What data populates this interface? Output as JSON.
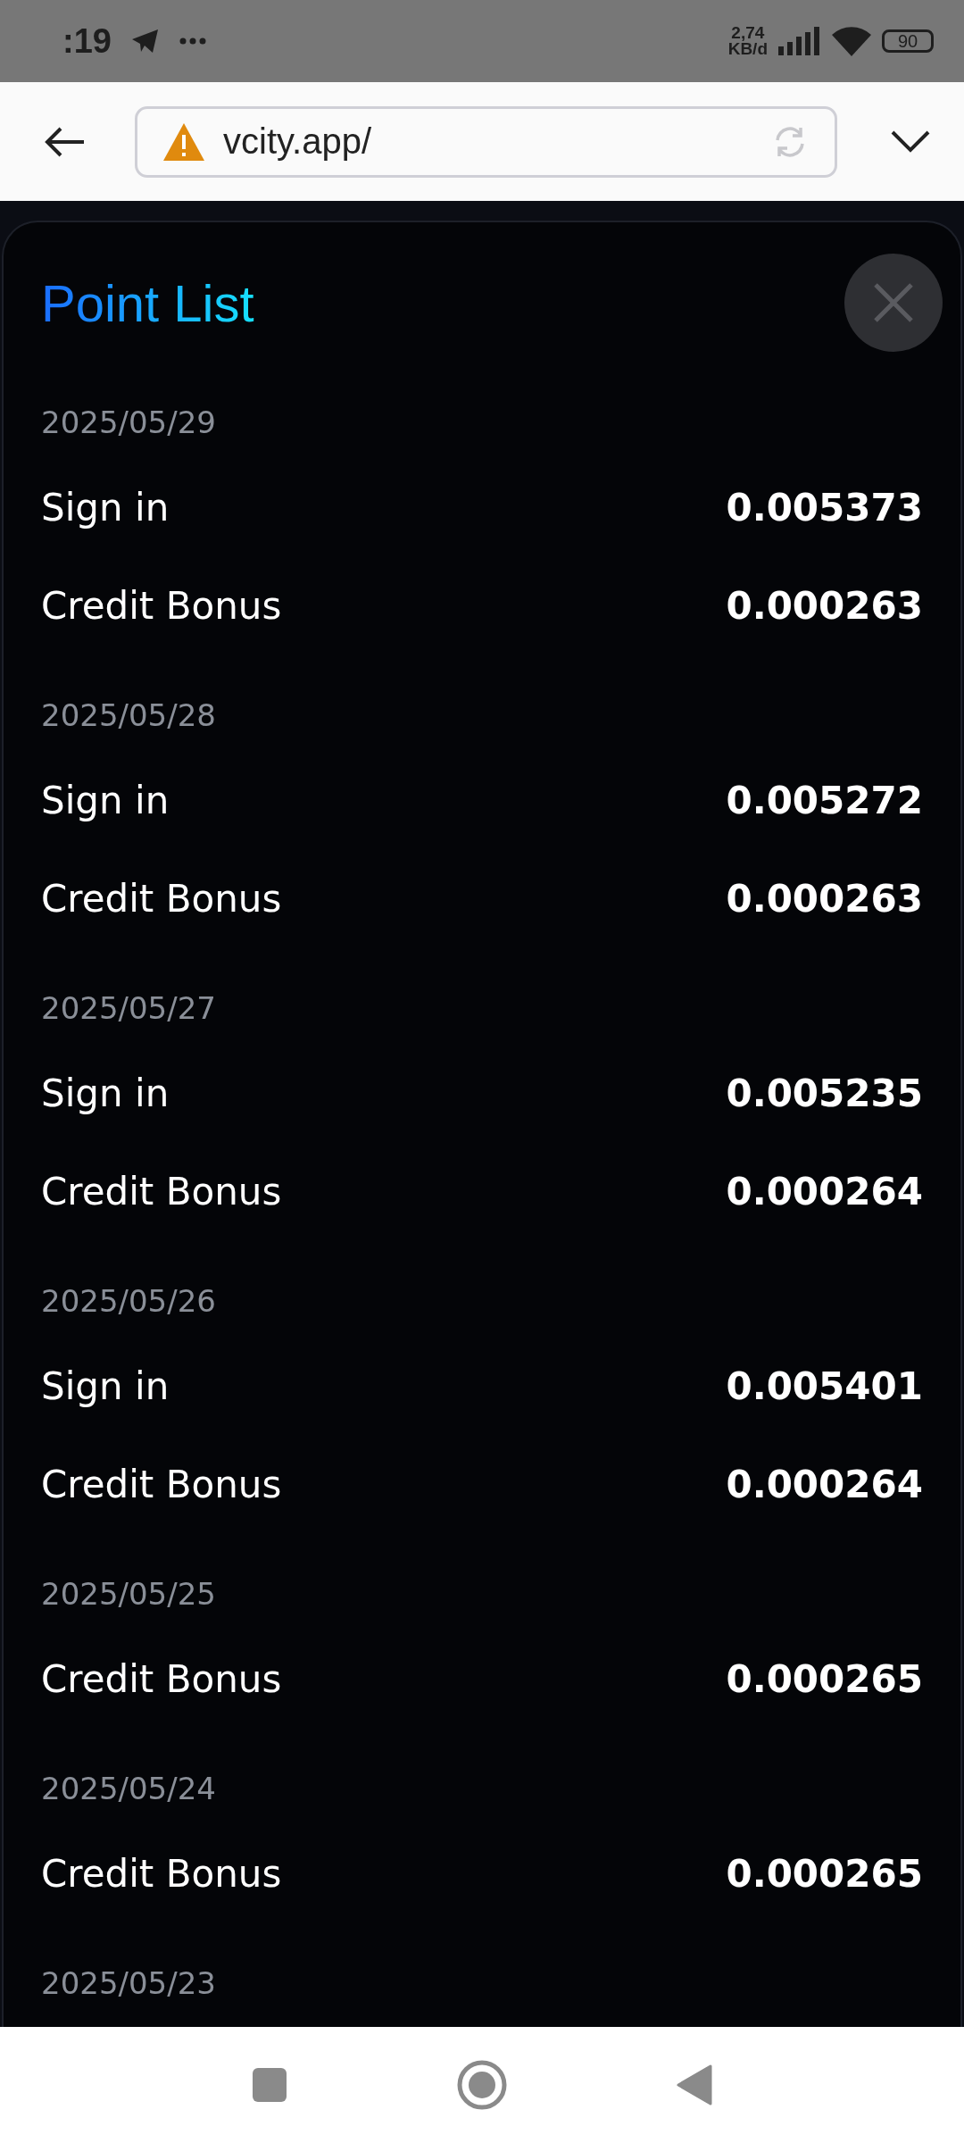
{
  "status_bar": {
    "time": ":19",
    "speed_value": "2,74",
    "speed_unit": "KB/d",
    "battery": "90"
  },
  "browser": {
    "url": "vcity.app/"
  },
  "panel": {
    "title": "Point List",
    "groups": [
      {
        "date": "2025/05/29",
        "entries": [
          {
            "label": "Sign in",
            "value": "0.005373"
          },
          {
            "label": "Credit Bonus",
            "value": "0.000263"
          }
        ]
      },
      {
        "date": "2025/05/28",
        "entries": [
          {
            "label": "Sign in",
            "value": "0.005272"
          },
          {
            "label": "Credit Bonus",
            "value": "0.000263"
          }
        ]
      },
      {
        "date": "2025/05/27",
        "entries": [
          {
            "label": "Sign in",
            "value": "0.005235"
          },
          {
            "label": "Credit Bonus",
            "value": "0.000264"
          }
        ]
      },
      {
        "date": "2025/05/26",
        "entries": [
          {
            "label": "Sign in",
            "value": "0.005401"
          },
          {
            "label": "Credit Bonus",
            "value": "0.000264"
          }
        ]
      },
      {
        "date": "2025/05/25",
        "entries": [
          {
            "label": "Credit Bonus",
            "value": "0.000265"
          }
        ]
      },
      {
        "date": "2025/05/24",
        "entries": [
          {
            "label": "Credit Bonus",
            "value": "0.000265"
          }
        ]
      },
      {
        "date": "2025/05/23"
      }
    ]
  }
}
